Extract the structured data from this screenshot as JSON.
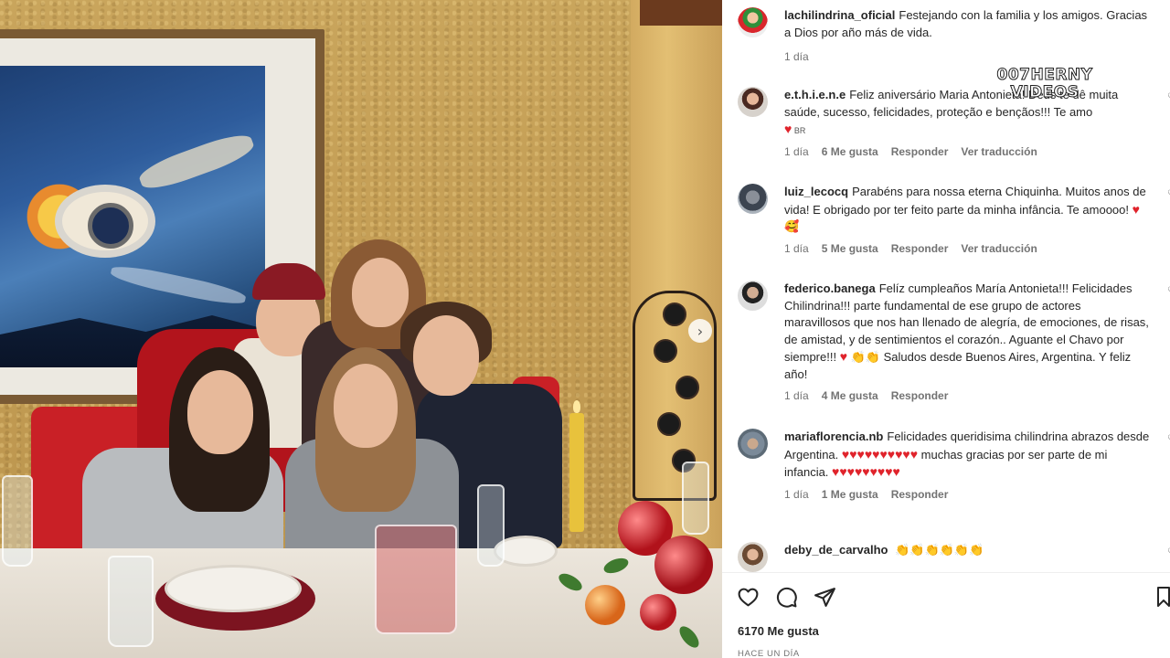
{
  "watermark": {
    "line1": "007HERNY",
    "line2": "VIDEOS"
  },
  "photo": {
    "next_arrow_glyph": "›"
  },
  "caption": {
    "user": "lachilindrina_oficial",
    "text": "Festejando con la familia y los amigos. Gracias a Dios por año más de vida.",
    "time": "1 día"
  },
  "comments": [
    {
      "user": "e.t.h.i.e.n.e",
      "text": "Feliz aniversário Maria Antonieta! Deus te dê muita saúde, sucesso, felicidades, proteção e bençãos!!! Te amo",
      "extra": "BR",
      "time": "1 día",
      "likes": "6 Me gusta",
      "reply": "Responder",
      "translate": "Ver traducción",
      "avatar_color": "#7a4b3a"
    },
    {
      "user": "luiz_lecocq",
      "text": "Parabéns para nossa eterna Chiquinha. Muitos anos de vida! E obrigado por ter feito parte da minha infância. Te amoooo!",
      "time": "1 día",
      "likes": "5 Me gusta",
      "reply": "Responder",
      "translate": "Ver traducción",
      "avatar_color": "#556070"
    },
    {
      "user": "federico.banega",
      "text": "Felíz cumpleaños María Antonieta!!! Felicidades Chilindrina!!! parte fundamental de ese grupo de actores maravillosos que nos han llenado de alegría, de emociones, de risas, de amistad, y de sentimientos el corazón.. Aguante el Chavo por siempre!!!",
      "text2": "Saludos desde Buenos Aires, Argentina. Y feliz año!",
      "time": "1 día",
      "likes": "4 Me gusta",
      "reply": "Responder",
      "avatar_color": "#3a3a3a"
    },
    {
      "user": "mariaflorencia.nb",
      "text": "Felicidades queridisima chilindrina abrazos desde Argentina.",
      "text2": "muchas gracias por ser parte de mi infancia.",
      "time": "1 día",
      "likes": "1 Me gusta",
      "reply": "Responder",
      "avatar_color": "#8a6e5a"
    },
    {
      "user": "deby_de_carvalho",
      "avatar_color": "#b08a6a"
    }
  ],
  "emoji": {
    "heart": "♥",
    "clap": "👏",
    "smile": "🥰"
  },
  "actions": {
    "like": "heart-outline",
    "comment": "comment-bubble",
    "share": "paper-plane",
    "save": "bookmark"
  },
  "likes_count": "6170 Me gusta",
  "post_time": "HACE UN DÍA"
}
